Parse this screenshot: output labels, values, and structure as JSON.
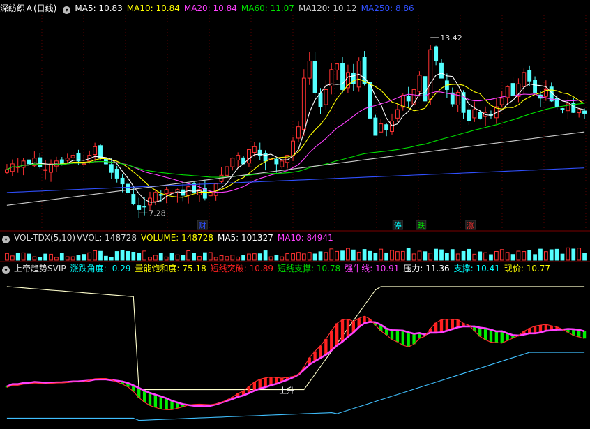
{
  "header": {
    "stock": "深纺织Ａ(日线)",
    "ma": [
      {
        "label": "MA5: 10.83",
        "color": "#ffffff"
      },
      {
        "label": "MA10: 10.84",
        "color": "#ffff00"
      },
      {
        "label": "MA20: 10.84",
        "color": "#ff40ff"
      },
      {
        "label": "MA60: 11.07",
        "color": "#00e000"
      },
      {
        "label": "MA120: 10.12",
        "color": "#cccccc"
      },
      {
        "label": "MA250: 8.86",
        "color": "#3050ff"
      }
    ]
  },
  "volume_header": {
    "name": "VOL-TDX(5,10)",
    "items": [
      {
        "label": "VVOL: 148728",
        "color": "#dddddd"
      },
      {
        "label": "VOLUME: 148728",
        "color": "#ffff00"
      },
      {
        "label": "MA5: 101327",
        "color": "#ffffff"
      },
      {
        "label": "MA10: 84941",
        "color": "#ff40ff"
      }
    ]
  },
  "indicator_header": {
    "name": "上帝趋势SVIP",
    "items": [
      {
        "label": "涨跌角度: -0.29",
        "color": "#00ffff"
      },
      {
        "label": "量能饱和度: 75.18",
        "color": "#ffff00"
      },
      {
        "label": "短线突破: 10.89",
        "color": "#ff2020"
      },
      {
        "label": "短线支撑: 10.78",
        "color": "#00e000"
      },
      {
        "label": "强牛线: 10.91",
        "color": "#ff40ff"
      },
      {
        "label": "压力: 11.36",
        "color": "#ffffff"
      },
      {
        "label": "支撑: 10.41",
        "color": "#00ffff"
      },
      {
        "label": "现价: 10.77",
        "color": "#ffff00"
      }
    ]
  },
  "chart_data": {
    "type": "candlestick",
    "annotations": {
      "high": "13.42",
      "low": "7.28",
      "rise": "上升",
      "markers": [
        {
          "text": "财",
          "color": "#3050ff",
          "pos": 0.34
        },
        {
          "text": "停",
          "color": "#00ffff",
          "pos": 0.675
        },
        {
          "text": "跌",
          "color": "#00e000",
          "pos": 0.715
        },
        {
          "text": "涨",
          "color": "#ff3030",
          "pos": 0.8
        }
      ]
    },
    "ylim": [
      6.8,
      14.2
    ],
    "closes": [
      8.8,
      9.0,
      8.9,
      9.1,
      9.0,
      9.2,
      8.9,
      8.8,
      9.0,
      9.1,
      9.0,
      9.2,
      9.3,
      9.1,
      9.0,
      9.3,
      9.6,
      9.2,
      9.0,
      8.7,
      8.5,
      8.3,
      8.0,
      7.6,
      7.4,
      7.5,
      7.8,
      8.0,
      7.9,
      8.1,
      8.0,
      8.1,
      7.9,
      8.2,
      8.0,
      8.1,
      7.8,
      8.0,
      8.3,
      8.6,
      8.9,
      9.2,
      9.3,
      9.0,
      9.5,
      9.6,
      9.3,
      9.1,
      9.2,
      9.0,
      9.1,
      9.3,
      9.8,
      10.3,
      12.0,
      12.6,
      11.5,
      11.0,
      11.6,
      12.3,
      12.5,
      11.6,
      12.2,
      11.8,
      12.6,
      11.8,
      10.6,
      10.0,
      10.4,
      10.2,
      10.5,
      10.9,
      11.4,
      11.2,
      11.6,
      12.1,
      11.2,
      13.0,
      12.6,
      12.0,
      11.6,
      11.1,
      11.5,
      10.8,
      10.5,
      10.9,
      10.6,
      10.8,
      10.7,
      11.0,
      11.3,
      11.7,
      11.4,
      11.8,
      12.2,
      11.9,
      11.5,
      11.3,
      11.6,
      11.2,
      11.0,
      10.9,
      11.1,
      10.8,
      10.9,
      10.77
    ]
  }
}
